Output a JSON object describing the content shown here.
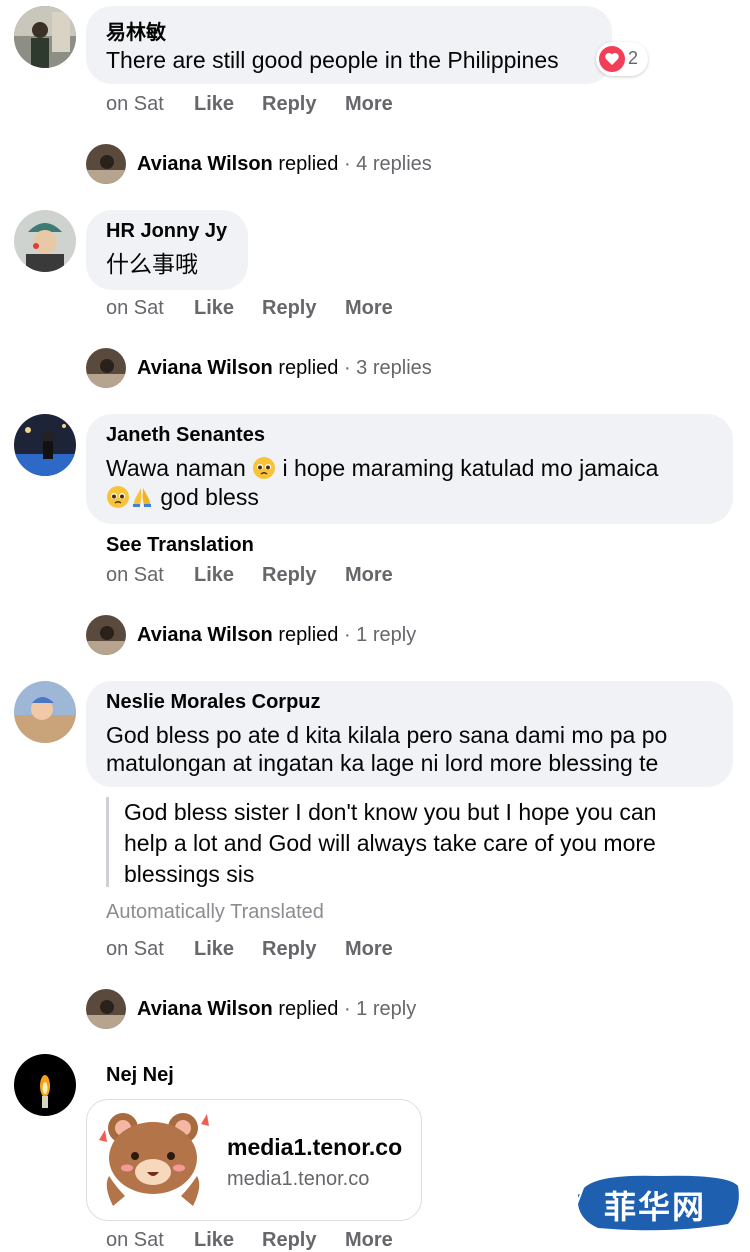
{
  "actions": {
    "time": "on Sat",
    "like": "Like",
    "reply": "Reply",
    "more": "More"
  },
  "comments": [
    {
      "name": "易林敏",
      "text": "There are still good people in the Philippines",
      "reaction_count": "2",
      "reply_author": "Aviana Wilson",
      "reply_verb": "replied",
      "reply_count": "· 4 replies"
    },
    {
      "name": "HR Jonny Jy",
      "text": "什么事哦",
      "reply_author": "Aviana Wilson",
      "reply_verb": "replied",
      "reply_count": "· 3 replies"
    },
    {
      "name": "Janeth Senantes",
      "text_a": "Wawa naman",
      "text_b": "i hope maraming katulad mo jamaica",
      "text_c": "god bless",
      "see_translation": "See Translation",
      "reply_author": "Aviana Wilson",
      "reply_verb": "replied",
      "reply_count": "· 1 reply"
    },
    {
      "name": "Neslie Morales Corpuz",
      "text_line1": "God bless po ate d kita kilala pero sana dami mo pa po",
      "text_line2": "matulongan at ingatan ka lage ni lord more blessing te",
      "translation_line1": "God bless sister I don't know you but I hope you can",
      "translation_line2": "help a lot and God will always take care of you more",
      "translation_line3": "blessings sis",
      "auto_translated": "Automatically Translated",
      "reply_author": "Aviana Wilson",
      "reply_verb": "replied",
      "reply_count": "· 1 reply"
    },
    {
      "name": "Nej Nej",
      "link_title": "media1.tenor.co",
      "link_domain": "media1.tenor.co"
    }
  ],
  "watermark": {
    "text": "菲华网"
  },
  "colors": {
    "bubble": "#f0f2f5",
    "secondary_text": "#65676b",
    "heart": "#f33e58",
    "watermark": "#1f5fb0"
  }
}
